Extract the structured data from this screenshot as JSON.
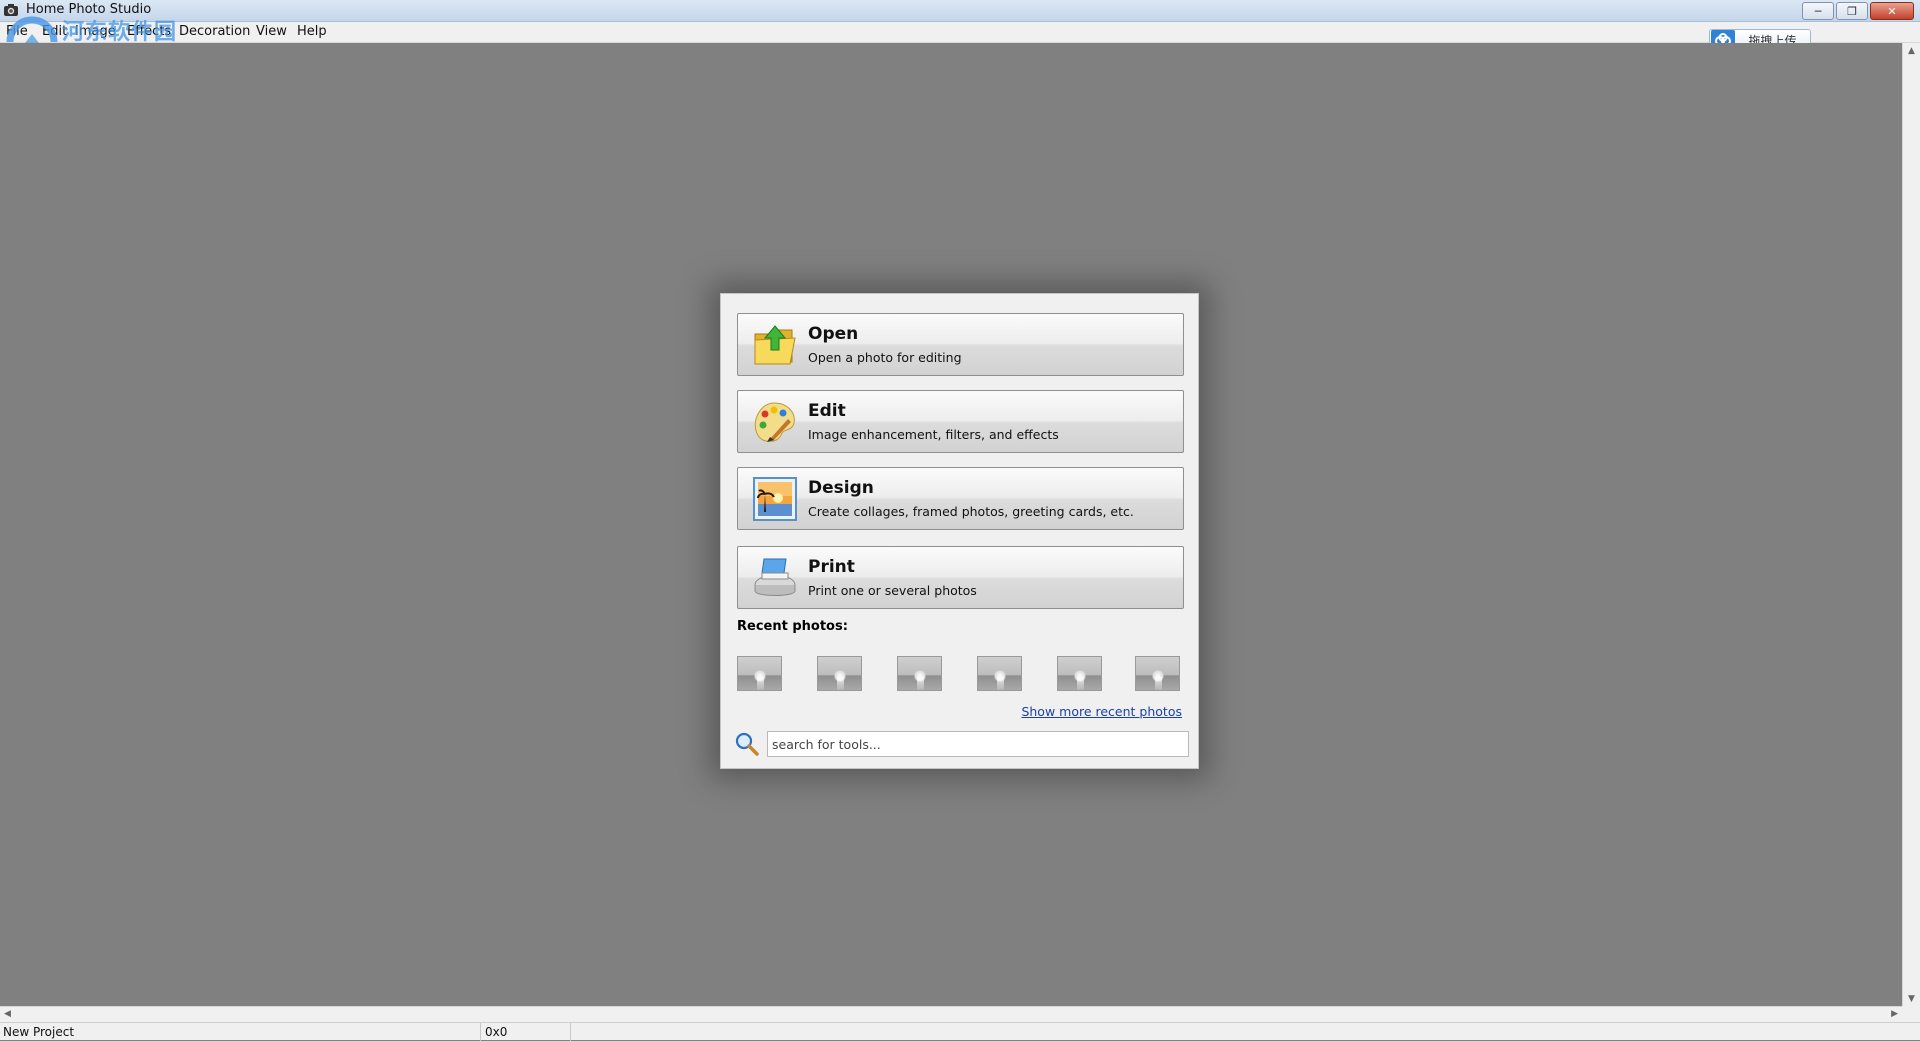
{
  "window": {
    "title": "Home Photo Studio",
    "buttons": {
      "minimize": "─",
      "restore": "❐",
      "close": "✕"
    }
  },
  "menu": [
    "File",
    "Edit",
    "Image",
    "Effects",
    "Decoration",
    "View",
    "Help"
  ],
  "watermark": {
    "text": "河东软件园",
    "url": "www.pc0359.cn"
  },
  "upload": {
    "label": "拖拽上传"
  },
  "dialog": {
    "actions": [
      {
        "title": "Open",
        "subtitle": "Open a photo for editing",
        "icon": "folder-up-arrow-icon"
      },
      {
        "title": "Edit",
        "subtitle": "Image enhancement, filters, and effects",
        "icon": "palette-brush-icon"
      },
      {
        "title": "Design",
        "subtitle": "Create collages, framed photos, greeting cards, etc.",
        "icon": "sunset-picture-icon"
      },
      {
        "title": "Print",
        "subtitle": "Print one or several photos",
        "icon": "printer-icon"
      }
    ],
    "recent_title": "Recent photos:",
    "recent_count_shown": 6,
    "more_link": "Show more recent photos",
    "search": {
      "placeholder": "search for tools...",
      "value": ""
    }
  },
  "status": {
    "project": "New Project",
    "dimensions": "0x0"
  },
  "colors": {
    "workspace": "#808080",
    "link": "#1a3fb0",
    "accent_green": "#2b9c3a"
  }
}
